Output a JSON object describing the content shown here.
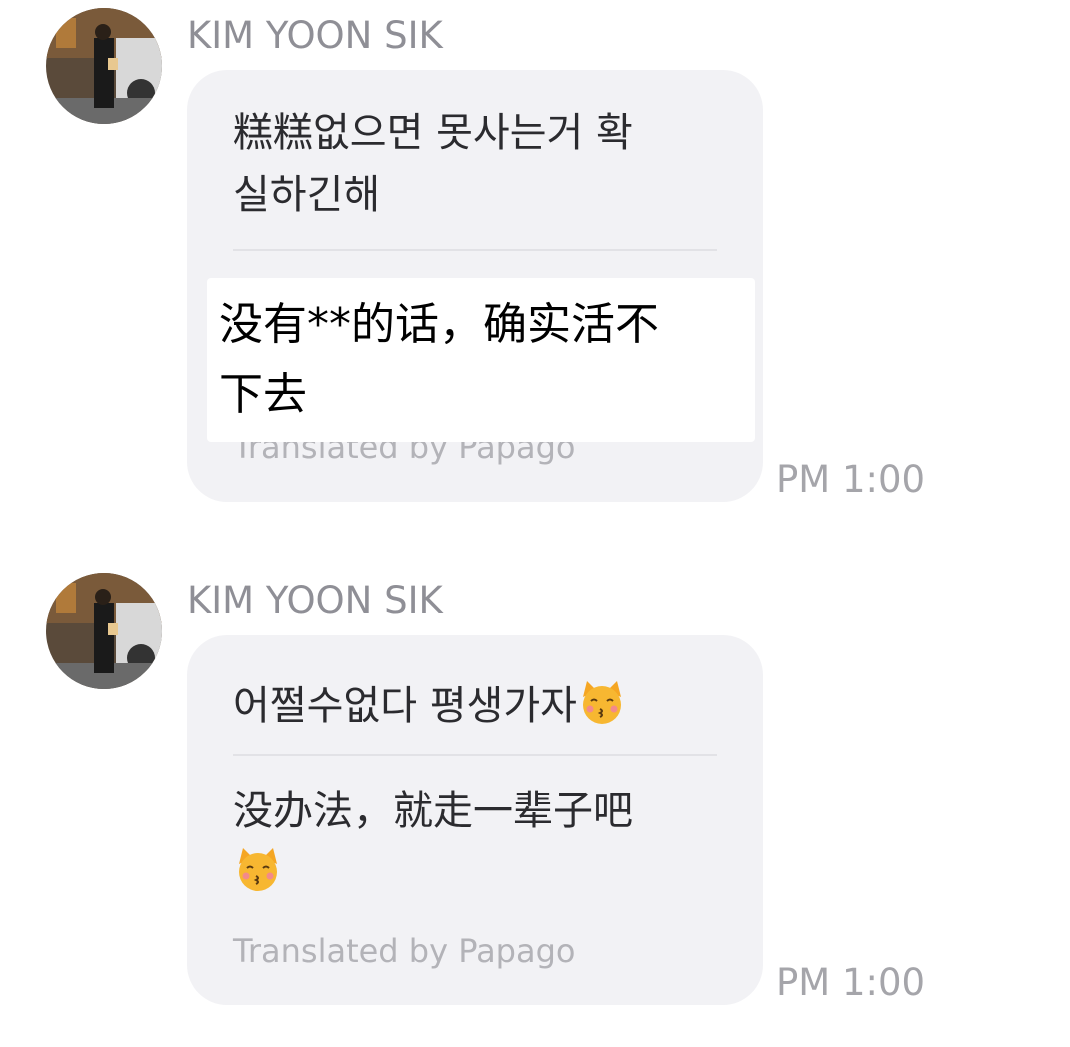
{
  "messages": [
    {
      "sender": "KIM YOON SIK",
      "original_line1": "糕糕없으면 못사는거 확",
      "original_line2": "실하긴해",
      "translation_line1": "没有**的话，确实活不",
      "translation_line2": "下去",
      "credit": "Translated by Papago",
      "time": "PM 1:00"
    },
    {
      "sender": "KIM YOON SIK",
      "original_text": "어쩔수없다 평생가자",
      "original_emoji": "kissing-cat-face",
      "translation_text": "没办法，就走一辈子吧",
      "translation_emoji": "kissing-cat-face",
      "credit": "Translated by Papago",
      "time": "PM 1:00"
    }
  ],
  "colors": {
    "bubble": "#f2f2f5",
    "sender": "#8f8f96",
    "time": "#a5a5aa",
    "credit": "#b3b3b8",
    "text": "#2b2b2f"
  }
}
